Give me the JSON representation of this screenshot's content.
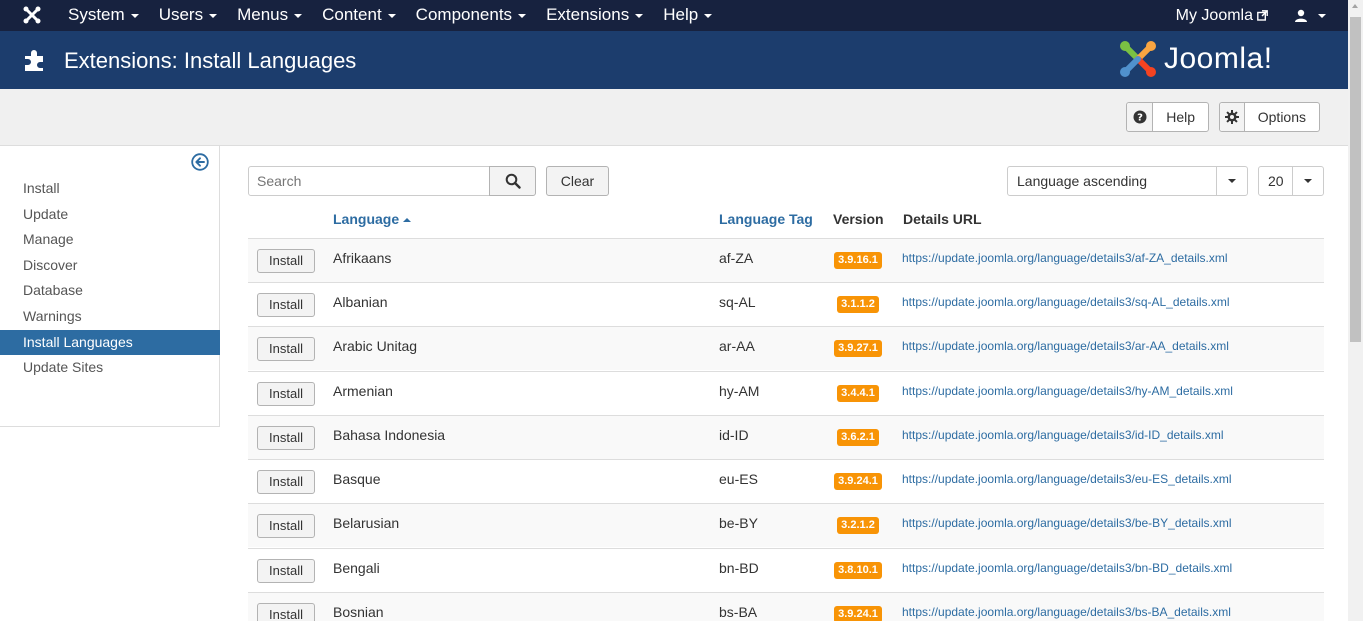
{
  "navbar": {
    "menus": [
      {
        "label": "System"
      },
      {
        "label": "Users"
      },
      {
        "label": "Menus"
      },
      {
        "label": "Content"
      },
      {
        "label": "Components"
      },
      {
        "label": "Extensions"
      },
      {
        "label": "Help"
      }
    ],
    "my_joomla": "My Joomla"
  },
  "header": {
    "title": "Extensions: Install Languages",
    "brand": "Joomla!"
  },
  "toolbar": {
    "help_label": "Help",
    "options_label": "Options"
  },
  "sidebar": {
    "items": [
      {
        "label": "Install"
      },
      {
        "label": "Update"
      },
      {
        "label": "Manage"
      },
      {
        "label": "Discover"
      },
      {
        "label": "Database"
      },
      {
        "label": "Warnings"
      },
      {
        "label": "Install Languages",
        "active": true
      },
      {
        "label": "Update Sites"
      }
    ]
  },
  "filters": {
    "search_placeholder": "Search",
    "clear_label": "Clear",
    "ordering": "Language ascending",
    "limit": "20"
  },
  "table": {
    "headers": {
      "language": "Language",
      "tag": "Language Tag",
      "version": "Version",
      "url": "Details URL"
    },
    "install_label": "Install",
    "rows": [
      {
        "language": "Afrikaans",
        "tag": "af-ZA",
        "version": "3.9.16.1",
        "url": "https://update.joomla.org/language/details3/af-ZA_details.xml"
      },
      {
        "language": "Albanian",
        "tag": "sq-AL",
        "version": "3.1.1.2",
        "url": "https://update.joomla.org/language/details3/sq-AL_details.xml"
      },
      {
        "language": "Arabic Unitag",
        "tag": "ar-AA",
        "version": "3.9.27.1",
        "url": "https://update.joomla.org/language/details3/ar-AA_details.xml"
      },
      {
        "language": "Armenian",
        "tag": "hy-AM",
        "version": "3.4.4.1",
        "url": "https://update.joomla.org/language/details3/hy-AM_details.xml"
      },
      {
        "language": "Bahasa Indonesia",
        "tag": "id-ID",
        "version": "3.6.2.1",
        "url": "https://update.joomla.org/language/details3/id-ID_details.xml"
      },
      {
        "language": "Basque",
        "tag": "eu-ES",
        "version": "3.9.24.1",
        "url": "https://update.joomla.org/language/details3/eu-ES_details.xml"
      },
      {
        "language": "Belarusian",
        "tag": "be-BY",
        "version": "3.2.1.2",
        "url": "https://update.joomla.org/language/details3/be-BY_details.xml"
      },
      {
        "language": "Bengali",
        "tag": "bn-BD",
        "version": "3.8.10.1",
        "url": "https://update.joomla.org/language/details3/bn-BD_details.xml"
      },
      {
        "language": "Bosnian",
        "tag": "bs-BA",
        "version": "3.9.24.1",
        "url": "https://update.joomla.org/language/details3/bs-BA_details.xml"
      }
    ]
  },
  "colors": {
    "navbar": "#17223f",
    "header": "#1c3d6d",
    "accent": "#2d6ca2",
    "version_badge": "#f89406"
  }
}
